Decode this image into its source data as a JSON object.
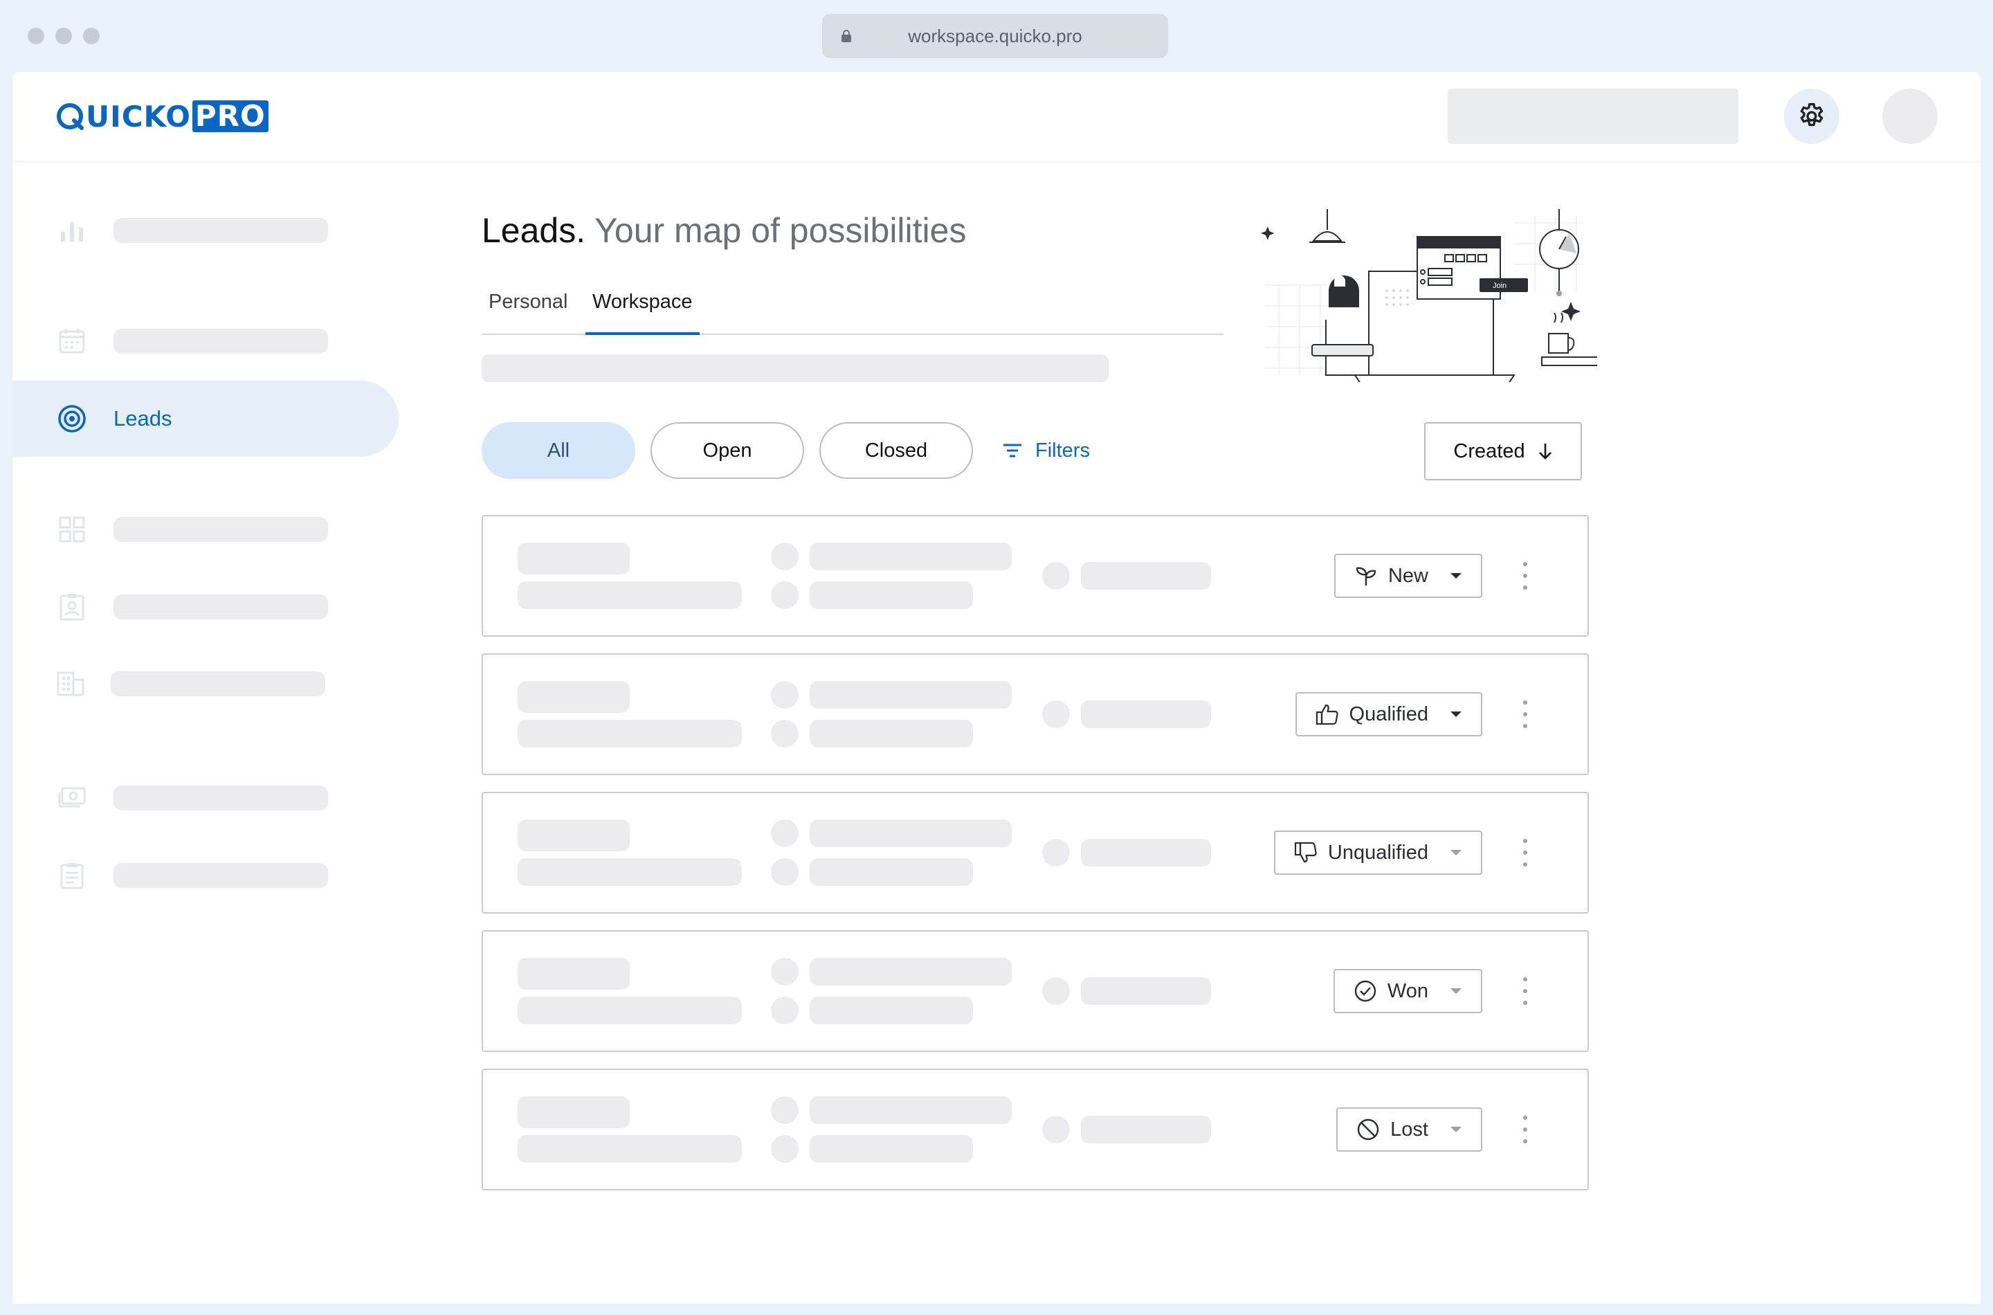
{
  "browser": {
    "url": "workspace.quicko.pro"
  },
  "app": {
    "logo_text": "UICKO",
    "logo_pro": "PRO"
  },
  "sidebar": {
    "active_item": "Leads"
  },
  "page": {
    "title": "Leads.",
    "subtitle": "Your map of possibilities",
    "tabs": [
      {
        "label": "Personal",
        "active": false
      },
      {
        "label": "Workspace",
        "active": true
      }
    ]
  },
  "filters": {
    "chips": [
      {
        "label": "All",
        "active": true
      },
      {
        "label": "Open",
        "active": false
      },
      {
        "label": "Closed",
        "active": false
      }
    ],
    "filters_label": "Filters",
    "sort_label": "Created",
    "illustration_button": "Join"
  },
  "leads": [
    {
      "status": "New",
      "icon": "sprout-icon"
    },
    {
      "status": "Qualified",
      "icon": "thumbs-up-icon"
    },
    {
      "status": "Unqualified",
      "icon": "thumbs-down-icon"
    },
    {
      "status": "Won",
      "icon": "check-circle-icon"
    },
    {
      "status": "Lost",
      "icon": "block-icon"
    }
  ],
  "colors": {
    "accent": "#0a66c2",
    "active_chip_bg": "#d6e6fb",
    "sidebar_active_bg": "#e6eef7",
    "skeleton": "#ececef",
    "frame": "#e9f1fa"
  }
}
